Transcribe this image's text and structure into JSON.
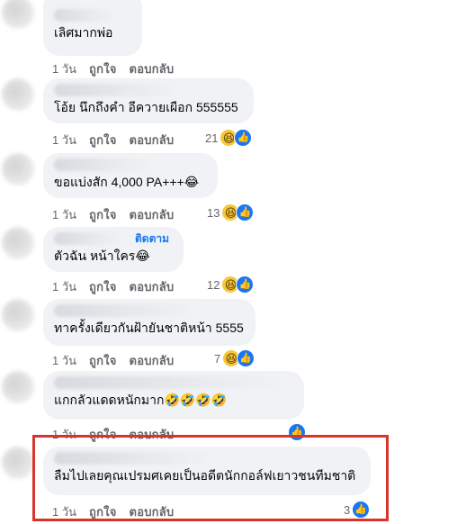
{
  "labels": {
    "time": "1 วัน",
    "like": "ถูกใจ",
    "reply": "ตอบกลับ"
  },
  "comments": [
    {
      "text": "เลิศมากพ่อ",
      "reaction_count": ""
    },
    {
      "text": "โอ้ย นึกถึงคำ อีควายเผือก 555555",
      "reaction_count": "21"
    },
    {
      "text": "ขอแบ่งสัก 4,000 PA+++😂",
      "reaction_count": "13"
    },
    {
      "text": "ตัวฉัน หน้าใคร😂",
      "follow": "ติดตาม",
      "reaction_count": "12"
    },
    {
      "text": "ทาครั้งเดียวกันฝ้ายันชาติหน้า 5555",
      "reaction_count": "7"
    },
    {
      "text": "แกกลัวแดดหนักมาก🤣🤣🤣🤣",
      "reaction_count": ""
    },
    {
      "text": "ลืมไปเลยคุณเปรมศเคยเป็นอดีตนักกอล์ฟเยาวชนทีมชาติ",
      "reaction_count": "3",
      "highlighted": true
    }
  ],
  "icons": {
    "haha": "laughing-emoji-icon",
    "like": "thumbs-up-icon"
  },
  "colors": {
    "bubble": "#f0f2f5",
    "meta": "#65676b",
    "link": "#1877f2",
    "highlight": "#d9342b"
  }
}
